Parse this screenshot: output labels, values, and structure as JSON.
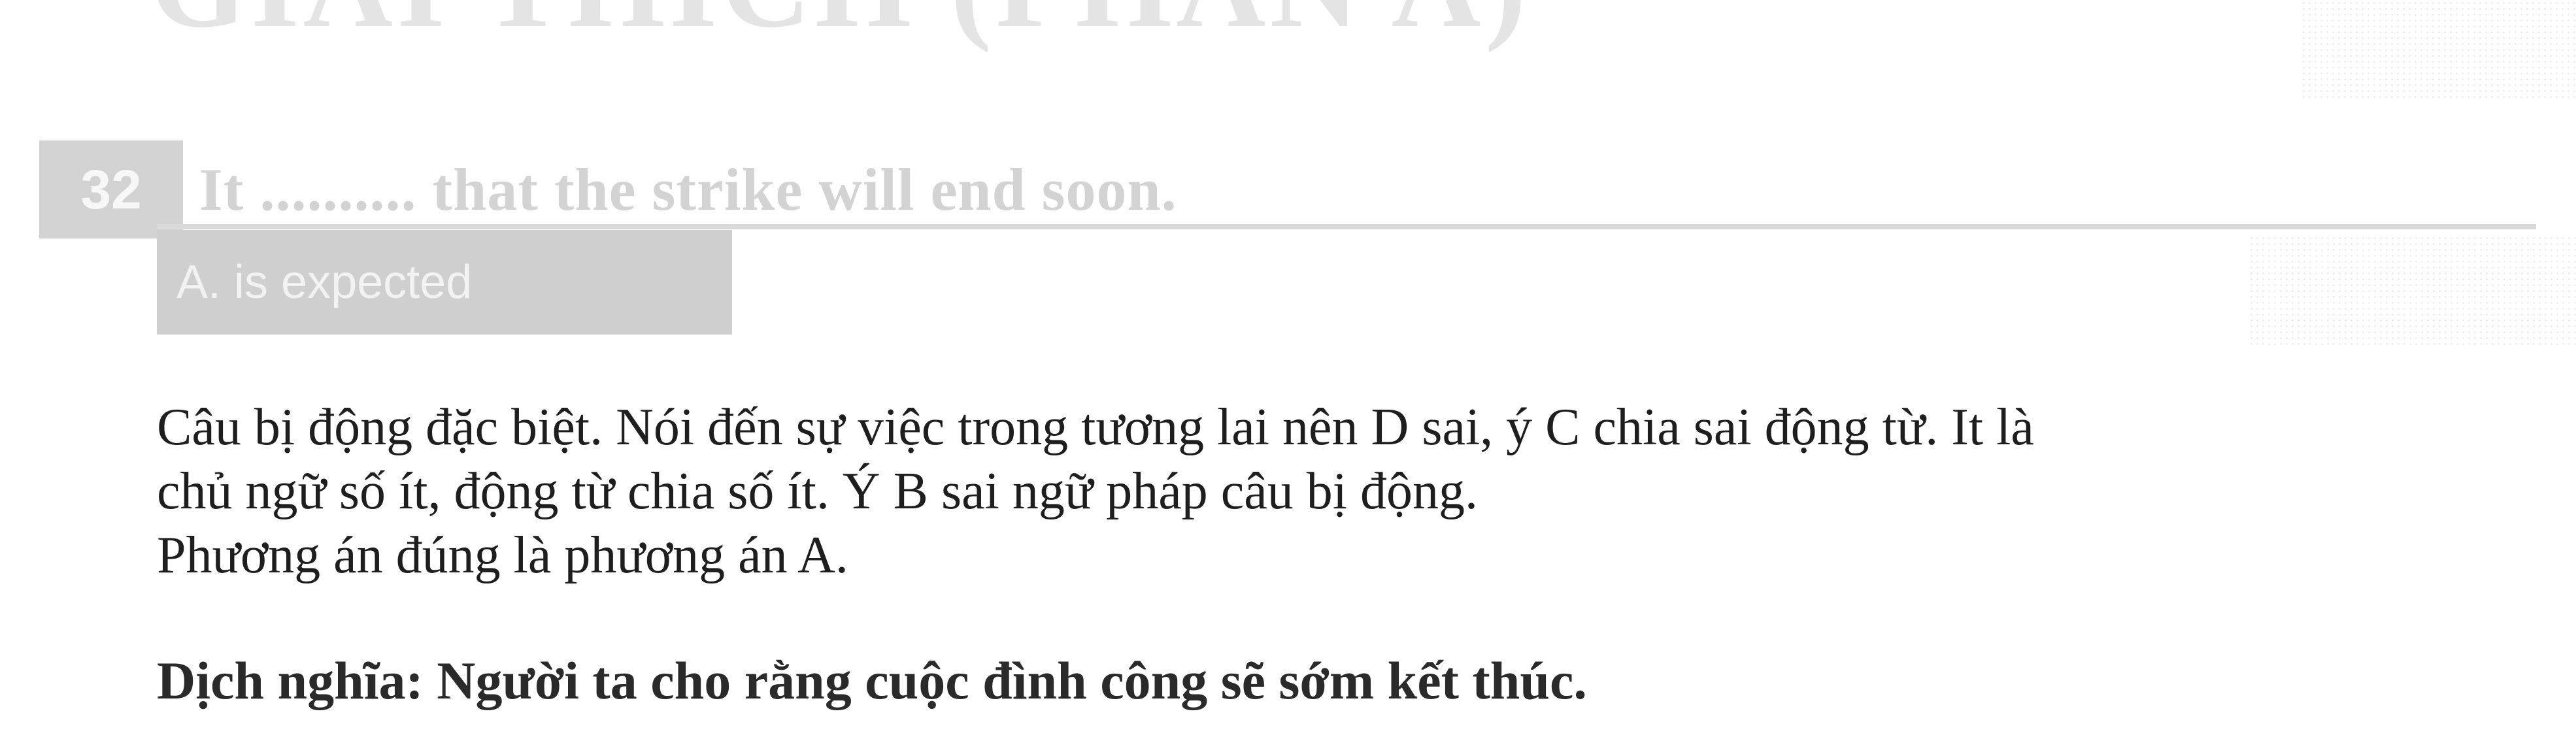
{
  "header": {
    "faded_heading": "GIẢI THÍCH (PHẦN A)"
  },
  "question": {
    "number": "32",
    "text": "It .......... that the strike will end soon."
  },
  "answer": {
    "label": "A. is expected"
  },
  "explanation": {
    "lines": [
      "Câu bị động đặc biệt. Nói đến sự việc trong tương lai nên D sai, ý C chia sai động từ. It là",
      "chủ ngữ số ít, động từ chia số ít. Ý B sai ngữ pháp câu bị động.",
      "Phương án đúng là phương án A."
    ]
  },
  "translation": {
    "text": "Dịch nghĩa: Người ta cho rằng cuộc đình công sẽ sớm kết thúc."
  }
}
